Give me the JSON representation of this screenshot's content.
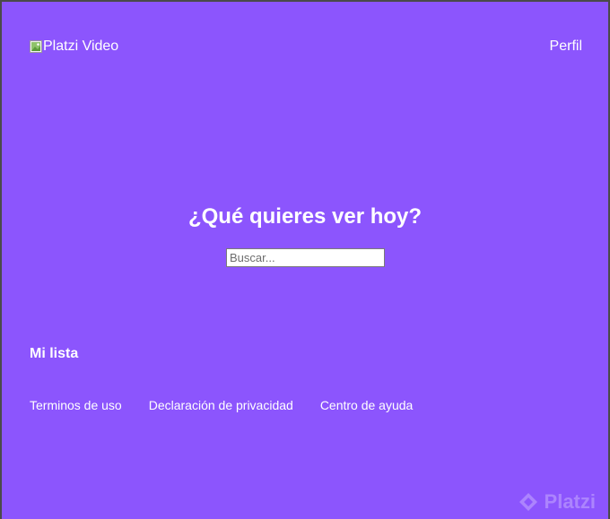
{
  "header": {
    "logo_alt": "Platzi Video",
    "profile_label": "Perfil"
  },
  "hero": {
    "title": "¿Qué quieres ver hoy?",
    "search": {
      "placeholder": "Buscar...",
      "value": ""
    }
  },
  "list": {
    "title": "Mi lista"
  },
  "footer": {
    "links": [
      {
        "label": "Terminos de uso"
      },
      {
        "label": "Declaración de privacidad"
      },
      {
        "label": "Centro de ayuda"
      }
    ]
  },
  "watermark": {
    "text": "Platzi"
  },
  "colors": {
    "background": "#8c55fd",
    "text": "#ffffff"
  }
}
